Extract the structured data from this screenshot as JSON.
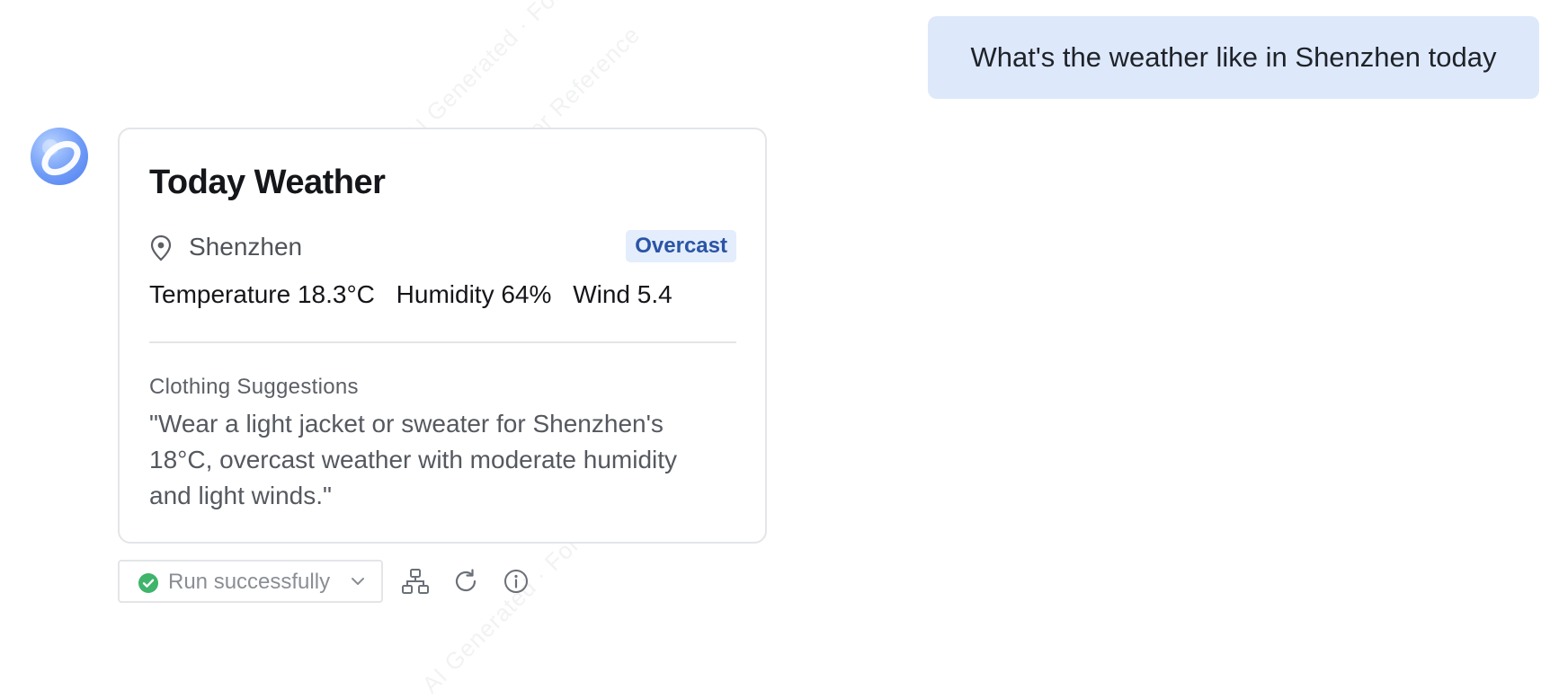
{
  "watermark": {
    "text": "AI Generated · For Reference"
  },
  "user_message": {
    "text": "What's the weather like in Shenzhen today"
  },
  "assistant": {
    "avatar_icon": "assistant-logo-icon",
    "card": {
      "title": "Today Weather",
      "location_icon": "map-pin-icon",
      "city": "Shenzhen",
      "condition_badge": "Overcast",
      "metrics": {
        "temperature": "Temperature 18.3°C",
        "humidity": "Humidity 64%",
        "wind": "Wind 5.4"
      },
      "clothing_label": "Clothing Suggestions",
      "clothing_text": "\"Wear a light jacket or sweater for Shenzhen's 18°C, overcast weather with moderate humidity and light winds.\""
    },
    "toolbar": {
      "status_label": "Run successfully",
      "status_icon": "check-circle-icon",
      "dropdown_icon": "chevron-down-icon",
      "icons": [
        "workflow-icon",
        "refresh-icon",
        "info-icon"
      ]
    }
  },
  "colors": {
    "user_bubble_bg": "#dde8fb",
    "badge_bg": "#e3edfc",
    "badge_text": "#2a54a6",
    "success_green": "#3fb46b",
    "card_border": "#e3e5e8"
  }
}
